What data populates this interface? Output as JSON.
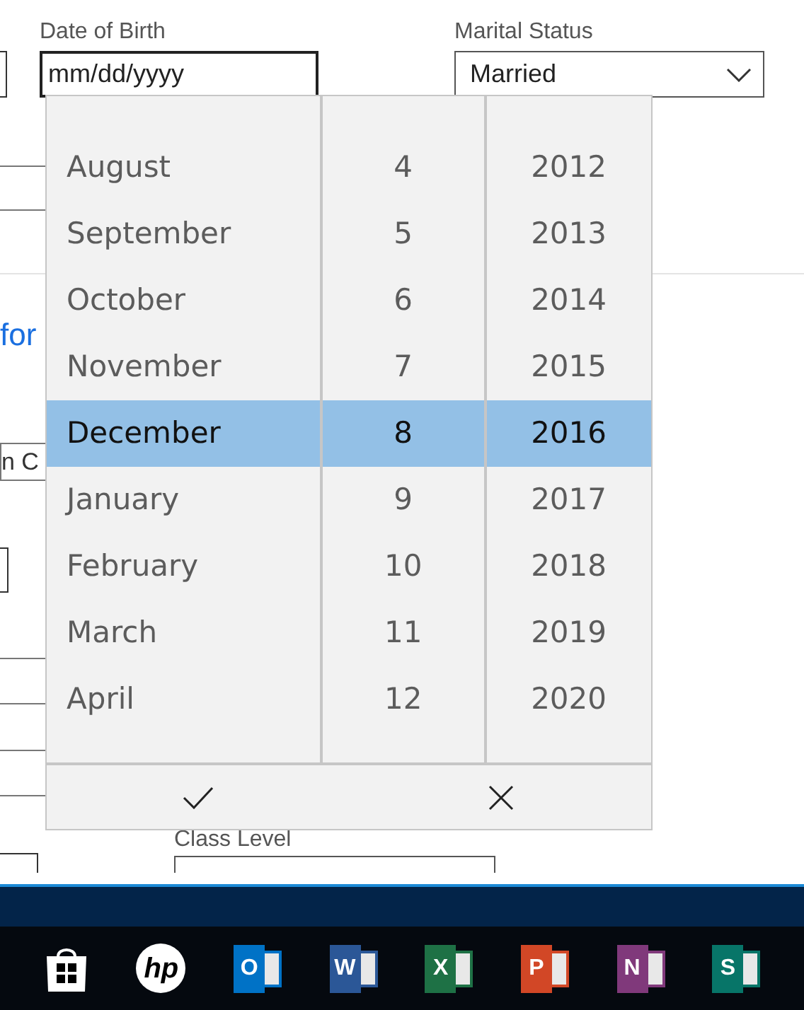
{
  "form": {
    "date_of_birth": {
      "label": "Date of Birth",
      "placeholder": "mm/dd/yyyy"
    },
    "marital_status": {
      "label": "Marital Status",
      "value": "Married"
    },
    "section_heading": "for",
    "field_fragment": "n C",
    "class_level": {
      "label": "Class Level"
    }
  },
  "date_picker": {
    "months": [
      {
        "label": "August",
        "selected": false
      },
      {
        "label": "September",
        "selected": false
      },
      {
        "label": "October",
        "selected": false
      },
      {
        "label": "November",
        "selected": false
      },
      {
        "label": "December",
        "selected": true
      },
      {
        "label": "January",
        "selected": false
      },
      {
        "label": "February",
        "selected": false
      },
      {
        "label": "March",
        "selected": false
      },
      {
        "label": "April",
        "selected": false
      }
    ],
    "days": [
      {
        "label": "4",
        "selected": false
      },
      {
        "label": "5",
        "selected": false
      },
      {
        "label": "6",
        "selected": false
      },
      {
        "label": "7",
        "selected": false
      },
      {
        "label": "8",
        "selected": true
      },
      {
        "label": "9",
        "selected": false
      },
      {
        "label": "10",
        "selected": false
      },
      {
        "label": "11",
        "selected": false
      },
      {
        "label": "12",
        "selected": false
      }
    ],
    "years": [
      {
        "label": "2012",
        "selected": false
      },
      {
        "label": "2013",
        "selected": false
      },
      {
        "label": "2014",
        "selected": false
      },
      {
        "label": "2015",
        "selected": false
      },
      {
        "label": "2016",
        "selected": true
      },
      {
        "label": "2017",
        "selected": false
      },
      {
        "label": "2018",
        "selected": false
      },
      {
        "label": "2019",
        "selected": false
      },
      {
        "label": "2020",
        "selected": false
      }
    ]
  },
  "taskbar": {
    "apps": [
      {
        "kind": "store"
      },
      {
        "kind": "hp",
        "letter": "hp"
      },
      {
        "kind": "office",
        "letter": "O",
        "color": "#0072c6"
      },
      {
        "kind": "office",
        "letter": "W",
        "color": "#2b5797"
      },
      {
        "kind": "office",
        "letter": "X",
        "color": "#1e7145"
      },
      {
        "kind": "office",
        "letter": "P",
        "color": "#d24726"
      },
      {
        "kind": "office",
        "letter": "N",
        "color": "#80397b"
      },
      {
        "kind": "office",
        "letter": "S",
        "color": "#077568"
      }
    ]
  }
}
